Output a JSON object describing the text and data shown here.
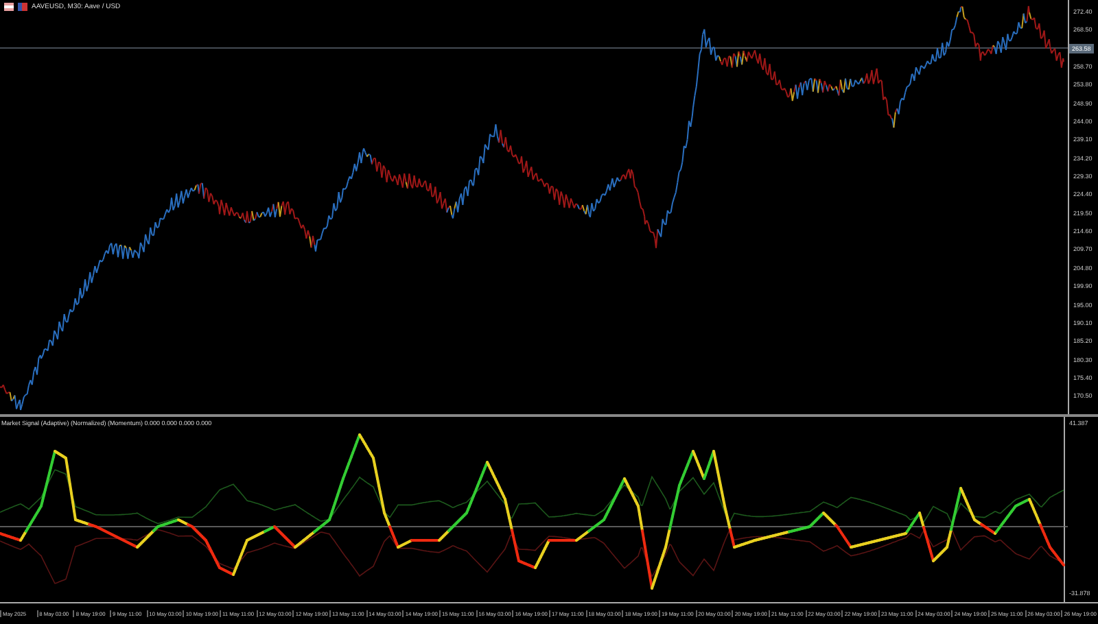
{
  "window": {
    "title": "AAVEUSD, M30:  Aave / USD"
  },
  "price_axis": {
    "labels": [
      "272.40",
      "268.50",
      "258.70",
      "253.80",
      "248.90",
      "244.00",
      "239.10",
      "234.20",
      "229.30",
      "224.40",
      "219.50",
      "214.60",
      "209.70",
      "204.80",
      "199.90",
      "195.00",
      "190.10",
      "185.20",
      "180.30",
      "175.40",
      "170.50"
    ],
    "current_price": "263.58"
  },
  "indicator": {
    "title": "Market Signal (Adaptive) (Normalized) (Momentum) 0.000 0.000 0.000 0.000",
    "scale_max": "41.387",
    "scale_min": "-31.878"
  },
  "time_axis": {
    "labels": [
      "May 2025",
      "8 May 03:00",
      "8 May 19:00",
      "9 May 11:00",
      "10 May 03:00",
      "10 May 19:00",
      "11 May 11:00",
      "12 May 03:00",
      "12 May 19:00",
      "13 May 11:00",
      "14 May 03:00",
      "14 May 19:00",
      "15 May 11:00",
      "16 May 03:00",
      "16 May 19:00",
      "17 May 11:00",
      "18 May 03:00",
      "18 May 19:00",
      "19 May 11:00",
      "20 May 03:00",
      "20 May 19:00",
      "21 May 11:00",
      "22 May 03:00",
      "22 May 19:00",
      "23 May 11:00",
      "24 May 03:00",
      "24 May 19:00",
      "25 May 11:00",
      "26 May 03:00",
      "26 May 19:00"
    ]
  }
}
